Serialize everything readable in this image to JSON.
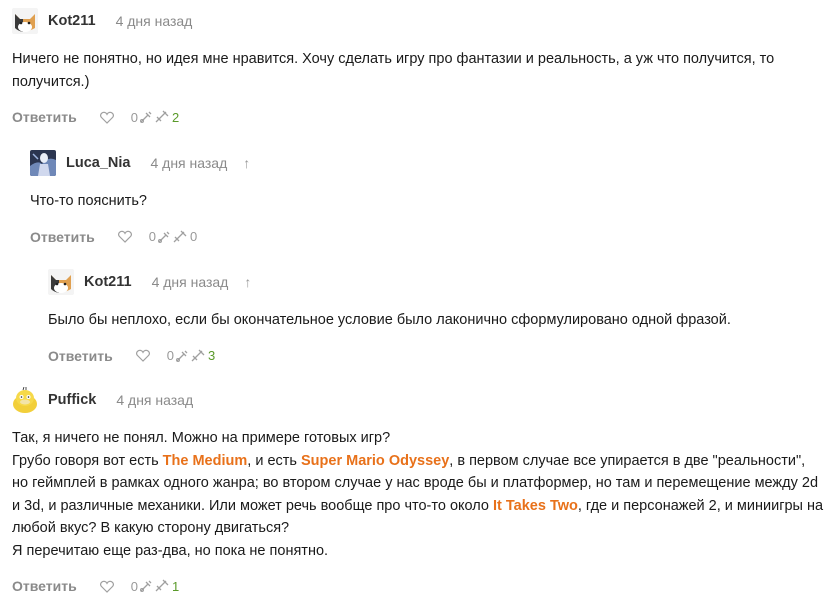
{
  "comments": [
    {
      "author": "Kot211",
      "time": "4 дня назад",
      "lines": [
        "Ничего не понятно, но идея мне нравится. Хочу сделать игру про фантазии и реальность, а уж что получится, то получится.)"
      ],
      "reply_label": "Ответить",
      "likes": "0",
      "rating": "2",
      "avatar": "cat-avatar"
    },
    {
      "author": "Luca_Nia",
      "time": "4 дня назад",
      "up_arrow": "↑",
      "lines": [
        "Что-то пояснить?"
      ],
      "reply_label": "Ответить",
      "likes": "0",
      "rating": "0",
      "avatar": "dark-figure-avatar"
    },
    {
      "author": "Kot211",
      "time": "4 дня назад",
      "up_arrow": "↑",
      "lines": [
        "Было бы неплохо, если бы окончательное условие было лаконично сформулировано одной фразой."
      ],
      "reply_label": "Ответить",
      "likes": "0",
      "rating": "3",
      "avatar": "cat-avatar"
    },
    {
      "author": "Puffick",
      "time": "4 дня назад",
      "reply_label": "Ответить",
      "likes": "0",
      "rating": "1",
      "avatar": "yellow-duck-avatar",
      "text": {
        "l1": "Так, я ничего не понял. Можно на примере готовых игр?",
        "l2a": "Грубо говоря вот есть ",
        "game1": "The Medium",
        "l2b": ", и есть ",
        "game2": "Super Mario Odyssey",
        "l2c": ", в первом случае все упирается в две \"реальности\", но геймплей в рамках одного жанра; во втором случае у нас вроде бы и платформер, но там и перемещение между 2d и 3d, и различные механики. Или может речь вообще про что-то около ",
        "game3": "It Takes Two",
        "l2d": ", где и персонажей 2, и миниигры на любой вкус? В какую сторону двигаться?",
        "l3": "Я перечитаю еще раз-два, но пока не понятно."
      }
    }
  ],
  "colors": {
    "accent": "#e8711a",
    "rating_green": "#5a9a2a",
    "muted": "#8a8a8a"
  },
  "icons": [
    "heart-icon",
    "dislike-icon",
    "reward-icon",
    "reply-arrow-icon"
  ]
}
